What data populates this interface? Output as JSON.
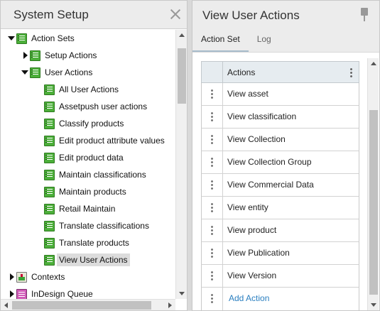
{
  "left_panel": {
    "title": "System Setup",
    "tree": [
      {
        "label": "Action Sets",
        "icon": "action-set-icon",
        "expander": "down",
        "level": 0
      },
      {
        "label": "Setup Actions",
        "icon": "action-set-icon",
        "expander": "right",
        "level": 1
      },
      {
        "label": "User Actions",
        "icon": "action-set-icon",
        "expander": "down",
        "level": 1
      },
      {
        "label": "All User Actions",
        "icon": "action-set-icon",
        "expander": "none",
        "level": 2
      },
      {
        "label": "Assetpush user actions",
        "icon": "action-set-icon",
        "expander": "none",
        "level": 2
      },
      {
        "label": "Classify products",
        "icon": "action-set-icon",
        "expander": "none",
        "level": 2
      },
      {
        "label": "Edit product attribute values",
        "icon": "action-set-icon",
        "expander": "none",
        "level": 2
      },
      {
        "label": "Edit product data",
        "icon": "action-set-icon",
        "expander": "none",
        "level": 2
      },
      {
        "label": "Maintain classifications",
        "icon": "action-set-icon",
        "expander": "none",
        "level": 2
      },
      {
        "label": "Maintain products",
        "icon": "action-set-icon",
        "expander": "none",
        "level": 2
      },
      {
        "label": "Retail Maintain",
        "icon": "action-set-icon",
        "expander": "none",
        "level": 2
      },
      {
        "label": "Translate classifications",
        "icon": "action-set-icon",
        "expander": "none",
        "level": 2
      },
      {
        "label": "Translate products",
        "icon": "action-set-icon",
        "expander": "none",
        "level": 2
      },
      {
        "label": "View User Actions",
        "icon": "action-set-icon",
        "expander": "none",
        "level": 2,
        "selected": true
      },
      {
        "label": "Contexts",
        "icon": "contexts-icon",
        "expander": "right",
        "level": 0
      },
      {
        "label": "InDesign Queue",
        "icon": "indesign-queue-icon",
        "expander": "right",
        "level": 0
      }
    ]
  },
  "right_panel": {
    "title": "View User Actions",
    "tabs": [
      {
        "label": "Action Set",
        "active": true
      },
      {
        "label": "Log",
        "active": false
      }
    ],
    "grid": {
      "column_header": "Actions",
      "rows": [
        "View asset",
        "View classification",
        "View Collection",
        "View Collection Group",
        "View Commercial Data",
        "View entity",
        "View product",
        "View Publication",
        "View Version"
      ],
      "add_label": "Add Action"
    }
  },
  "colors": {
    "accent_tab_underline": "#a7bccb",
    "link": "#2a7fc0",
    "selection": "#dcdcdc"
  }
}
